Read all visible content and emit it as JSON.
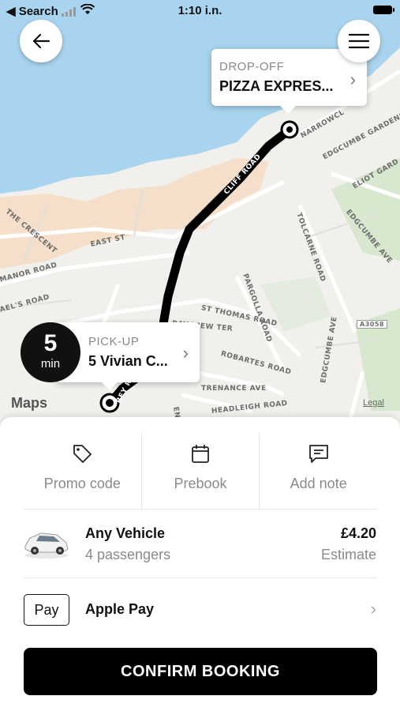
{
  "status_bar": {
    "back_app": "◀ Search",
    "time": "1:10 i.n."
  },
  "map": {
    "logo": "Maps",
    "legal": "Legal",
    "street_labels": [
      "CLIFF ROAD",
      "NARROWCL",
      "EDGCUMBE GARDENS",
      "ELIOT GARD",
      "EDGCUMBE AVE",
      "TOLCARNE ROAD",
      "THE CRESCENT",
      "EAST ST",
      "MANOR ROAD",
      "AEL'S ROAD",
      "PARGOLLA ROAD",
      "ST THOMAS ROAD",
      "BAY VIEW TER",
      "ROBARTES ROAD",
      "TRENANCE AVE",
      "HEADLEIGH ROAD",
      "A3058",
      "EDGCUMBE AVE",
      "ENANCE",
      "REY ROAD"
    ]
  },
  "dropoff": {
    "label": "DROP-OFF",
    "place": "PIZZA EXPRES..."
  },
  "pickup": {
    "label": "PICK-UP",
    "place": "5 Vivian C..."
  },
  "eta": {
    "value": "5",
    "unit": "min"
  },
  "actions": [
    {
      "label": "Promo code",
      "icon": "tag-icon"
    },
    {
      "label": "Prebook",
      "icon": "calendar-icon"
    },
    {
      "label": "Add note",
      "icon": "message-icon"
    }
  ],
  "vehicle": {
    "name": "Any Vehicle",
    "passengers": "4 passengers",
    "price": "£4.20",
    "price_note": "Estimate"
  },
  "payment": {
    "badge": "Pay",
    "method": "Apple Pay"
  },
  "confirm_label": "CONFIRM BOOKING",
  "colors": {
    "water": "#a9d4ef",
    "land": "#f1f0ec",
    "built": "#f6dcc4",
    "park": "#d8e8cf",
    "route": "#000000",
    "button": "#000000"
  }
}
